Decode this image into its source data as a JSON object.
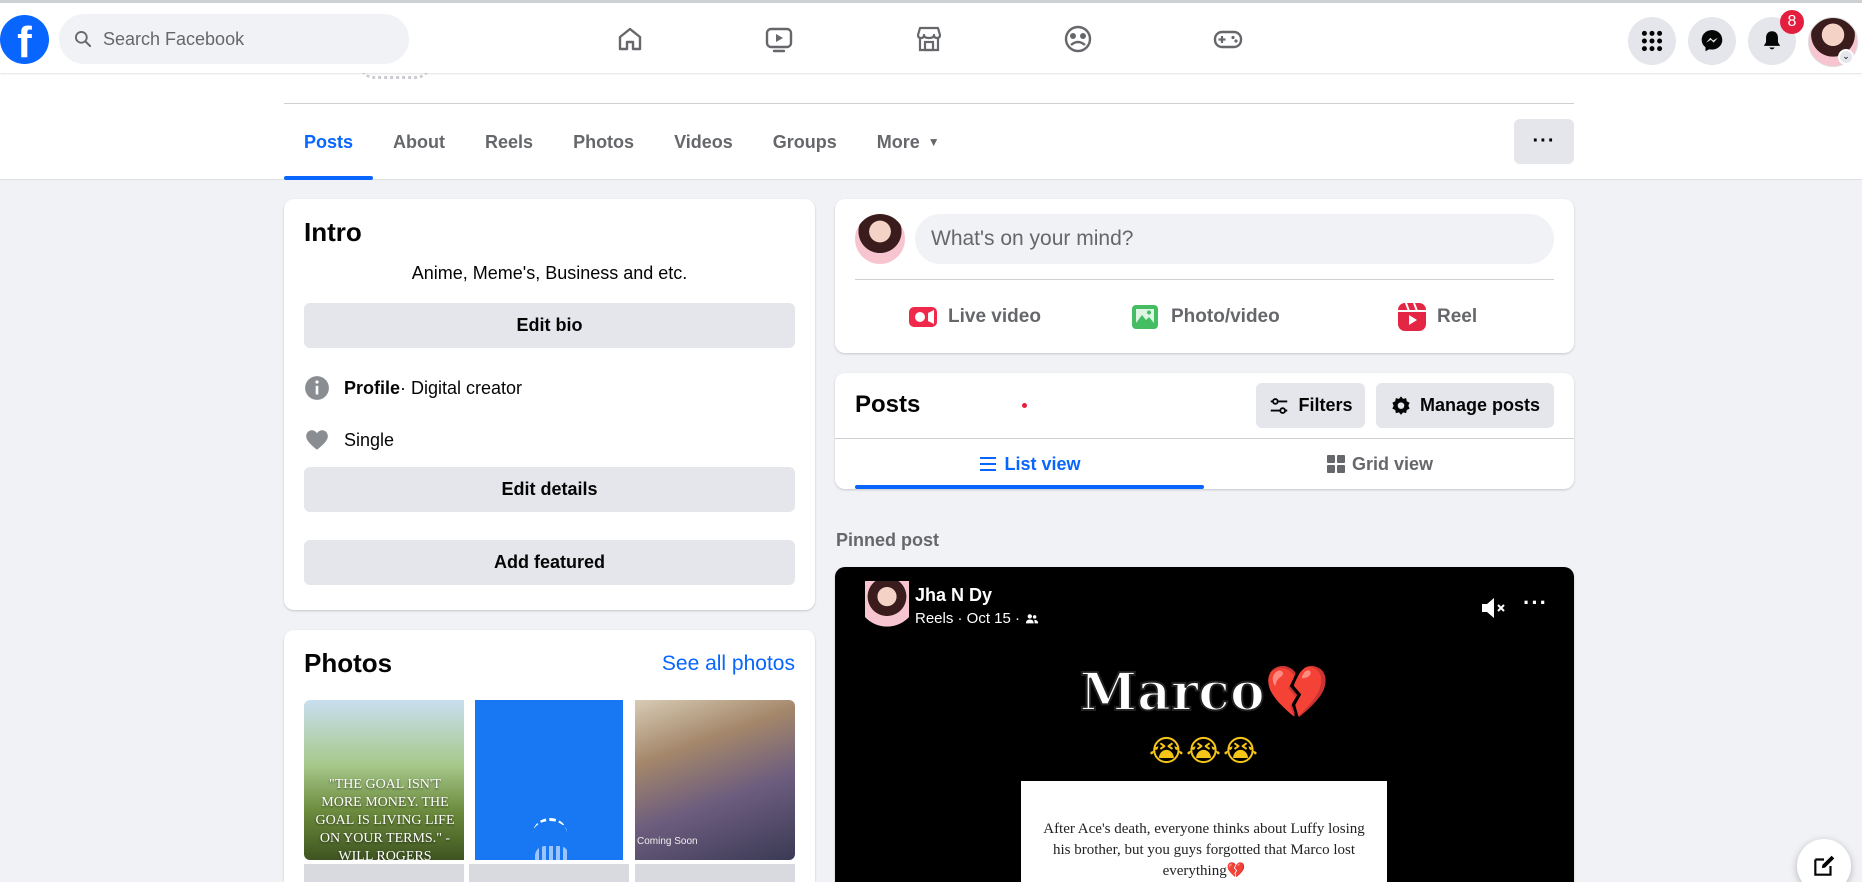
{
  "topbar": {
    "logo": "f",
    "search_placeholder": "Search Facebook",
    "nav_icons": [
      "home-icon",
      "watch-icon",
      "marketplace-icon",
      "groups-icon",
      "gaming-icon"
    ],
    "right_icons": [
      "menu-grid-icon",
      "messenger-icon",
      "notifications-icon"
    ],
    "notification_count": "8"
  },
  "profile_tabs": {
    "items": [
      "Posts",
      "About",
      "Reels",
      "Photos",
      "Videos",
      "Groups"
    ],
    "more_label": "More",
    "active": "Posts",
    "overflow_label": "···"
  },
  "intro": {
    "title": "Intro",
    "bio": "Anime, Meme's, Business and etc.",
    "edit_bio": "Edit bio",
    "profile_label": "Profile",
    "profile_detail": " · Digital creator",
    "relationship": "Single",
    "edit_details": "Edit details",
    "add_featured": "Add featured"
  },
  "photos": {
    "title": "Photos",
    "see_all": "See all photos",
    "quote": "\"THE GOAL ISN'T MORE MONEY. THE GOAL IS LIVING LIFE ON YOUR TERMS.\" -WILL ROGERS",
    "thumb3_caption": "Coming Soon"
  },
  "composer": {
    "placeholder": "What's on your mind?",
    "live_video": "Live video",
    "photo_video": "Photo/video",
    "reel": "Reel"
  },
  "posts_section": {
    "title": "Posts",
    "filters": "Filters",
    "manage_posts": "Manage posts",
    "list_view": "List view",
    "grid_view": "Grid view",
    "active_view": "List view"
  },
  "pinned": {
    "label": "Pinned post",
    "author": "Jha N Dy",
    "meta": "Reels · Oct 15 ·",
    "reel_title": "Marco",
    "reel_heart": "💔",
    "reel_emoji": "😭😭😭",
    "reel_text": "After Ace's death, everyone thinks about Luffy losing his brother, but you guys forgotted that Marco  lost everything💔",
    "more_label": "···"
  },
  "colors": {
    "brand_blue": "#0866ff",
    "page_bg": "#f0f2f5",
    "badge_red": "#e41e3f",
    "live_red": "#f02849",
    "photo_green": "#45bd62",
    "reel_pink": "#e42645"
  }
}
